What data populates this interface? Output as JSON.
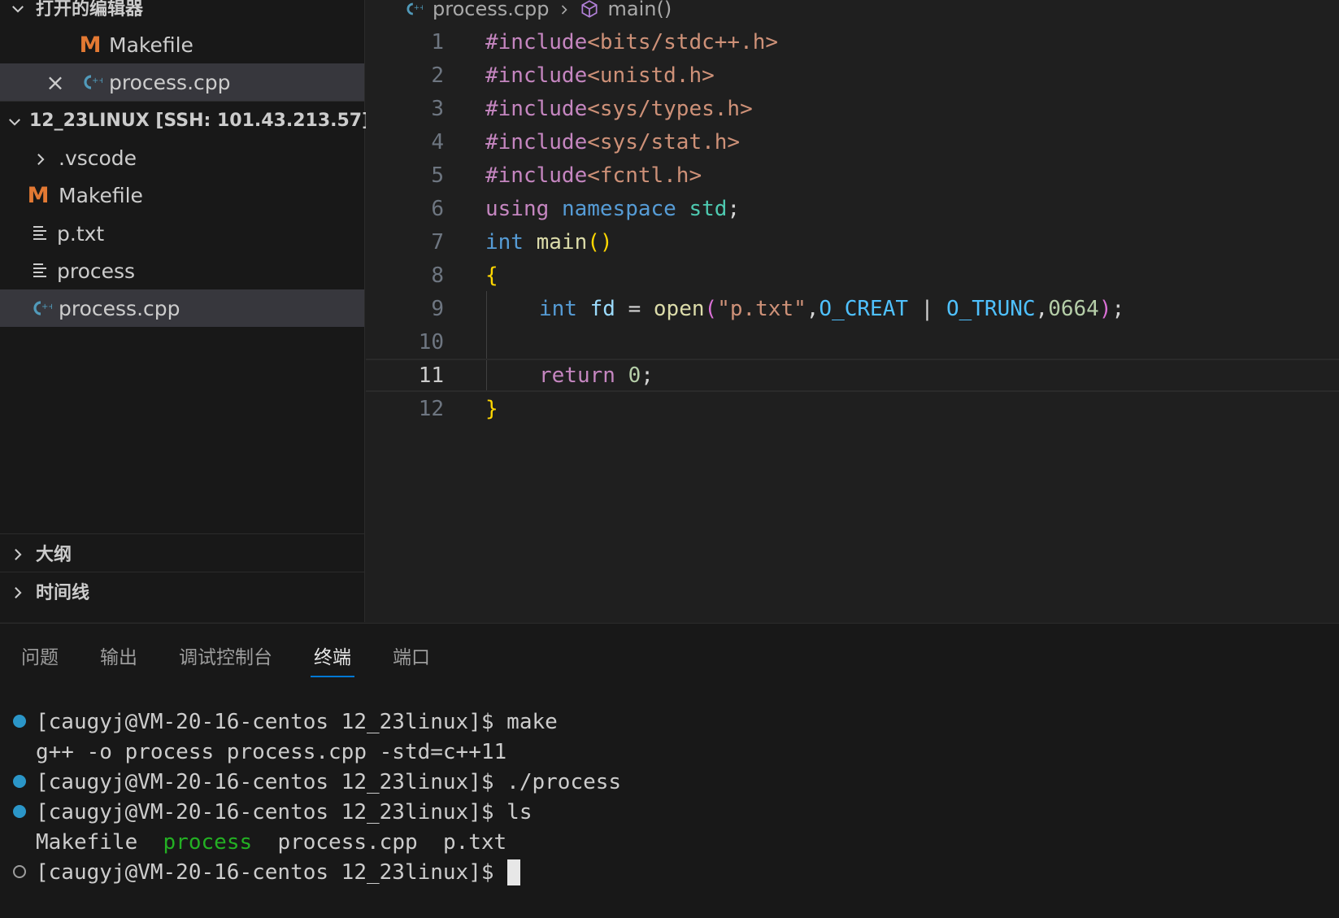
{
  "sidebar": {
    "open_editors_title": "打开的编辑器",
    "open_editors": [
      {
        "name": "Makefile",
        "icon": "makefile-icon"
      },
      {
        "name": "process.cpp",
        "icon": "cpp-icon",
        "close": "×"
      }
    ],
    "workspace_title": "12_23LINUX [SSH: 101.43.213.57]",
    "files": [
      {
        "name": ".vscode",
        "icon": "folder-chevron"
      },
      {
        "name": "Makefile",
        "icon": "makefile-icon"
      },
      {
        "name": "p.txt",
        "icon": "text-file-icon"
      },
      {
        "name": "process",
        "icon": "text-file-icon"
      },
      {
        "name": "process.cpp",
        "icon": "cpp-icon"
      }
    ],
    "outline_title": "大纲",
    "timeline_title": "时间线"
  },
  "editor": {
    "breadcrumb": {
      "file": "process.cpp",
      "symbol": "main()"
    },
    "line_numbers": [
      "1",
      "2",
      "3",
      "4",
      "5",
      "6",
      "7",
      "8",
      "9",
      "10",
      "11",
      "12"
    ],
    "current_line": "11",
    "code": {
      "l1_inc": "#include",
      "l1_hdr": "<bits/stdc++.h>",
      "l2_inc": "#include",
      "l2_hdr": "<unistd.h>",
      "l3_inc": "#include",
      "l3_hdr": "<sys/types.h>",
      "l4_inc": "#include",
      "l4_hdr": "<sys/stat.h>",
      "l5_inc": "#include",
      "l5_hdr": "<fcntl.h>",
      "l6_using": "using",
      "l6_namespace": "namespace",
      "l6_std": "std",
      "l6_semi": ";",
      "l7_int": "int",
      "l7_main": "main",
      "l7_parens": "()",
      "l8_brace": "{",
      "l9_int": "int",
      "l9_fd": "fd",
      "l9_eq": " = ",
      "l9_open": "open",
      "l9_lp": "(",
      "l9_str": "\"p.txt\"",
      "l9_c1": ",",
      "l9_creat": "O_CREAT",
      "l9_pipe": " | ",
      "l9_trunc": "O_TRUNC",
      "l9_c2": ",",
      "l9_num": "0664",
      "l9_rp": ")",
      "l9_semi": ";",
      "l11_return": "return",
      "l11_zero": "0",
      "l11_semi": ";",
      "l12_brace": "}"
    }
  },
  "panel": {
    "tabs": [
      "问题",
      "输出",
      "调试控制台",
      "终端",
      "端口"
    ],
    "active_tab": "终端",
    "terminal": {
      "line1": "[caugyj@VM-20-16-centos 12_23linux]$ make",
      "line2": "g++ -o process process.cpp -std=c++11",
      "line3": "[caugyj@VM-20-16-centos 12_23linux]$ ./process",
      "line4": "[caugyj@VM-20-16-centos 12_23linux]$ ls",
      "ls_1": "Makefile",
      "ls_2": "process",
      "ls_3": "process.cpp",
      "ls_4": "p.txt",
      "line6": "[caugyj@VM-20-16-centos 12_23linux]$"
    }
  },
  "colors": {
    "accent": "#0078d4",
    "makefile_icon": "#e37933",
    "cpp_icon": "#519aba",
    "terminal_dot": "#2b96c8",
    "executable_green": "#23b023"
  }
}
